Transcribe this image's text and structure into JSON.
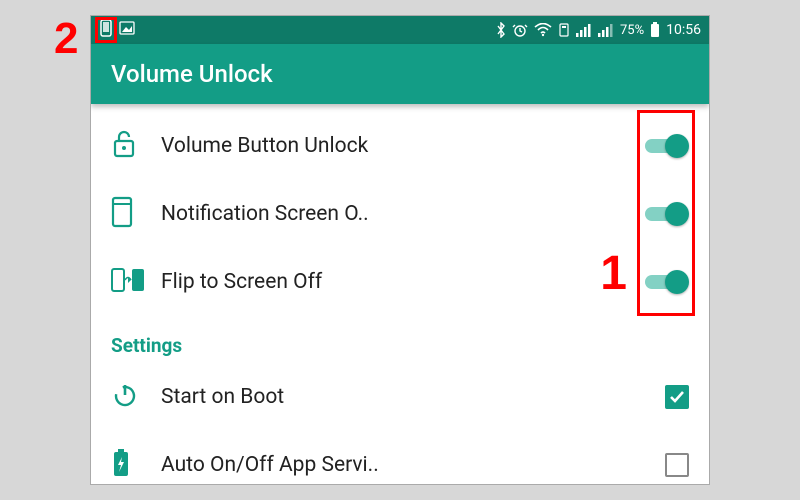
{
  "statusbar": {
    "battery_pct": "75%",
    "time": "10:56"
  },
  "appbar": {
    "title": "Volume Unlock"
  },
  "rows": [
    {
      "icon": "unlock-icon",
      "label": "Volume Button Unlock",
      "toggle_on": true
    },
    {
      "icon": "screen-icon",
      "label": "Notification Screen O..",
      "toggle_on": true
    },
    {
      "icon": "flip-icon",
      "label": "Flip to Screen Off",
      "toggle_on": true
    }
  ],
  "section_header": "Settings",
  "settings_rows": [
    {
      "icon": "power-icon",
      "label": "Start on Boot",
      "checked": true
    },
    {
      "icon": "battery-icon",
      "label": "Auto On/Off App Servi..",
      "checked": false
    }
  ],
  "annotations": {
    "num1": "1",
    "num2": "2"
  },
  "colors": {
    "accent": "#139d86",
    "statusbar": "#0e7a67",
    "annotation": "#ff0000"
  }
}
